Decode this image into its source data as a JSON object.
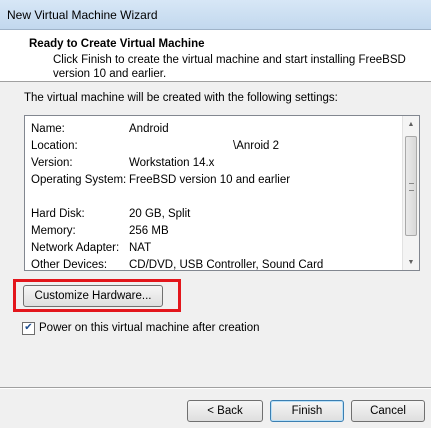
{
  "window": {
    "title": "New Virtual Machine Wizard"
  },
  "header": {
    "title": "Ready to Create Virtual Machine",
    "description": "Click Finish to create the virtual machine and start installing FreeBSD version 10 and earlier."
  },
  "intro": "The virtual machine will be created with the following settings:",
  "settings": {
    "name": {
      "label": "Name:",
      "value": "Android"
    },
    "location": {
      "label": "Location:",
      "value": "\\Anroid 2"
    },
    "version": {
      "label": "Version:",
      "value": "Workstation 14.x"
    },
    "os": {
      "label": "Operating System:",
      "value": "FreeBSD version 10 and earlier"
    },
    "hard_disk": {
      "label": "Hard Disk:",
      "value": "20 GB, Split"
    },
    "memory": {
      "label": "Memory:",
      "value": "256 MB"
    },
    "network": {
      "label": "Network Adapter:",
      "value": "NAT"
    },
    "other": {
      "label": "Other Devices:",
      "value": "CD/DVD, USB Controller, Sound Card"
    }
  },
  "buttons": {
    "customize": "Customize Hardware...",
    "back": "< Back",
    "finish": "Finish",
    "cancel": "Cancel"
  },
  "power_on": {
    "label": "Power on this virtual machine after creation",
    "checked": true
  },
  "colors": {
    "highlight": "#e3161c",
    "header_bg": "#ffffff",
    "dialog_bg": "#f0f0f0"
  },
  "icons": {
    "check": "check-icon",
    "scroll_up": "triangle-up-icon",
    "scroll_down": "triangle-down-icon"
  }
}
